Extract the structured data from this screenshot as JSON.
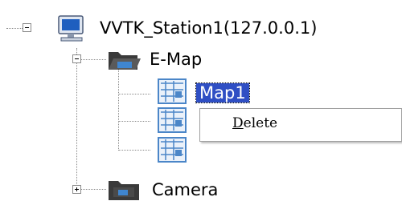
{
  "tree": {
    "station": {
      "label": "VVTK_Station1(127.0.0.1)",
      "expanded": true
    },
    "emap": {
      "label": "E-Map",
      "expanded": true,
      "maps": [
        {
          "label": "Map1",
          "selected": true
        },
        {
          "label": ""
        },
        {
          "label": ""
        }
      ]
    },
    "camera": {
      "label": "Camera",
      "expanded": false
    }
  },
  "context_menu": {
    "items": [
      {
        "mnemonic": "D",
        "rest": "elete"
      }
    ]
  },
  "colors": {
    "selection": "#2f4fc4",
    "folder": "#4a4a4a",
    "monitor": "#1f5fbf",
    "map_icon": "#4b86c8"
  },
  "icons": {
    "station": "monitor-icon",
    "emap": "open-folder-icon",
    "map": "map-icon",
    "camera": "camera-folder-icon"
  }
}
